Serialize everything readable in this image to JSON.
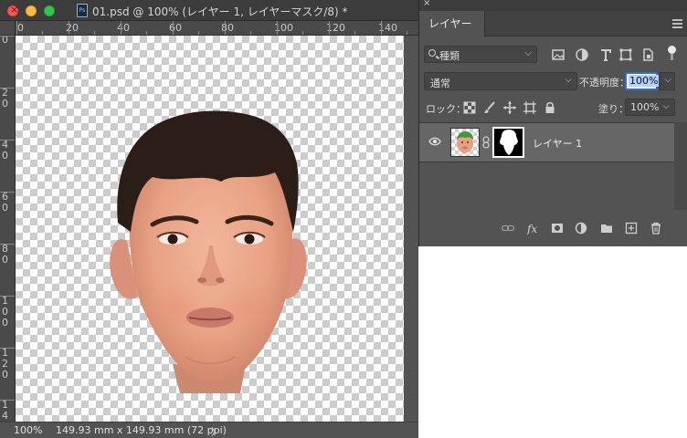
{
  "document": {
    "title": "01.psd @ 100% (レイヤー 1, レイヤーマスク/8) *",
    "app_icon_text": "Ps",
    "ruler_top_labels": [
      "0",
      "20",
      "40",
      "60",
      "80",
      "100",
      "120",
      "140"
    ],
    "ruler_left_labels": [
      "0",
      "2\n0",
      "4\n0",
      "6\n0",
      "8\n0",
      "1\n0\n0",
      "1\n2\n0",
      "1\n4"
    ],
    "status": {
      "zoom": "100%",
      "doc_size": "149.93 mm x 149.93 mm (72 ppi)",
      "arrow": "〉"
    }
  },
  "layers_panel": {
    "close_glyph": "×",
    "tab_label": "レイヤー",
    "filter": {
      "kind_label": "種類"
    },
    "blend_mode": "通常",
    "opacity_label": "不透明度：",
    "opacity_value": "100%",
    "lock_label": "ロック：",
    "fill_label": "塗り：",
    "fill_value": "100%",
    "layers": [
      {
        "name": "レイヤー 1",
        "visible": true,
        "has_mask": true
      }
    ]
  },
  "colors": {
    "selection_blue": "#2f6fd4",
    "traffic_red": "#fc5753",
    "traffic_yellow": "#fdbc40",
    "traffic_green": "#33c748",
    "thumb_green": "#3d9a3a"
  }
}
